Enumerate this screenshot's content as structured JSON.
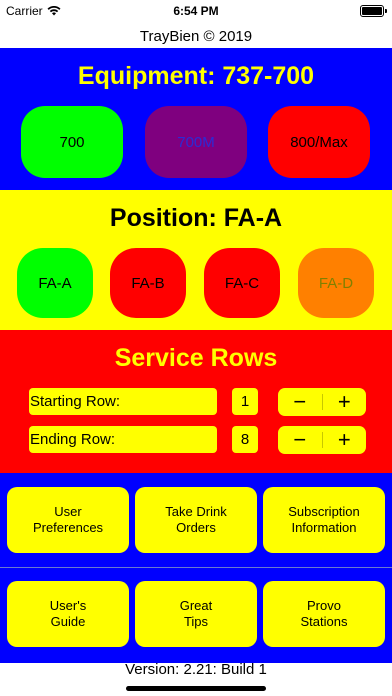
{
  "status_bar": {
    "carrier": "Carrier",
    "time": "6:54 PM",
    "icons": [
      "wifi-icon",
      "battery-icon"
    ]
  },
  "app": {
    "title": "TrayBien © 2019",
    "version": "Version: 2.21: Build 1"
  },
  "equipment": {
    "heading": "Equipment: 737-700",
    "buttons": [
      {
        "label": "700",
        "color": "#00ff00",
        "text_color": "#000000"
      },
      {
        "label": "700M",
        "color": "#7f007f",
        "text_color": "#2b2bd6"
      },
      {
        "label": "800/Max",
        "color": "#ff0000",
        "text_color": "#000000"
      }
    ]
  },
  "position": {
    "heading": "Position: FA-A",
    "buttons": [
      {
        "label": "FA-A",
        "color": "#00ff00",
        "text_color": "#000000"
      },
      {
        "label": "FA-B",
        "color": "#ff0000",
        "text_color": "#000000"
      },
      {
        "label": "FA-C",
        "color": "#ff0000",
        "text_color": "#000000"
      },
      {
        "label": "FA-D",
        "color": "#ff8000",
        "text_color": "#808000"
      }
    ]
  },
  "service_rows": {
    "heading": "Service Rows",
    "starting_row": {
      "label": "Starting Row:",
      "value": "1"
    },
    "ending_row": {
      "label": "Ending Row:",
      "value": "8"
    },
    "stepper": {
      "minus": "−",
      "plus": "+"
    }
  },
  "menu": {
    "buttons": [
      {
        "line1": "User",
        "line2": "Preferences"
      },
      {
        "line1": "Take Drink",
        "line2": "Orders"
      },
      {
        "line1": "Subscription",
        "line2": "Information"
      },
      {
        "line1": "User's",
        "line2": "Guide"
      },
      {
        "line1": "Great",
        "line2": "Tips"
      },
      {
        "line1": "Provo",
        "line2": "Stations"
      }
    ]
  },
  "colors": {
    "blue": "#0000ff",
    "yellow": "#ffff00",
    "red": "#ff0000",
    "green": "#00ff00"
  }
}
